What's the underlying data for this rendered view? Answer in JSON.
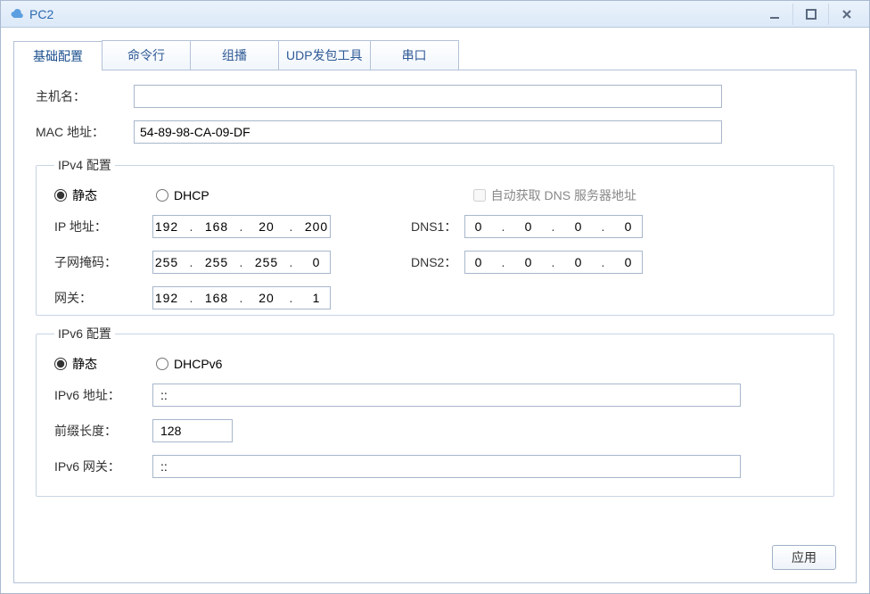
{
  "window": {
    "title": "PC2"
  },
  "tabs": [
    {
      "label": "基础配置",
      "active": true
    },
    {
      "label": "命令行",
      "active": false
    },
    {
      "label": "组播",
      "active": false
    },
    {
      "label": "UDP发包工具",
      "active": false
    },
    {
      "label": "串口",
      "active": false
    }
  ],
  "basic": {
    "hostname_label": "主机名：",
    "hostname_value": "",
    "mac_label": "MAC 地址：",
    "mac_value": "54-89-98-CA-09-DF"
  },
  "ipv4": {
    "legend": "IPv4 配置",
    "static_label": "静态",
    "dhcp_label": "DHCP",
    "mode": "static",
    "auto_dns_label": "自动获取 DNS 服务器地址",
    "auto_dns_checked": false,
    "ip_label": "IP 地址：",
    "ip": [
      "192",
      "168",
      "20",
      "200"
    ],
    "mask_label": "子网掩码：",
    "mask": [
      "255",
      "255",
      "255",
      "0"
    ],
    "gateway_label": "网关：",
    "gateway": [
      "192",
      "168",
      "20",
      "1"
    ],
    "dns1_label": "DNS1：",
    "dns1": [
      "0",
      "0",
      "0",
      "0"
    ],
    "dns2_label": "DNS2：",
    "dns2": [
      "0",
      "0",
      "0",
      "0"
    ]
  },
  "ipv6": {
    "legend": "IPv6 配置",
    "static_label": "静态",
    "dhcpv6_label": "DHCPv6",
    "mode": "static",
    "addr_label": "IPv6 地址：",
    "addr_value": "::",
    "prefix_label": "前缀长度：",
    "prefix_value": "128",
    "gw_label": "IPv6 网关：",
    "gw_value": "::"
  },
  "buttons": {
    "apply": "应用"
  }
}
